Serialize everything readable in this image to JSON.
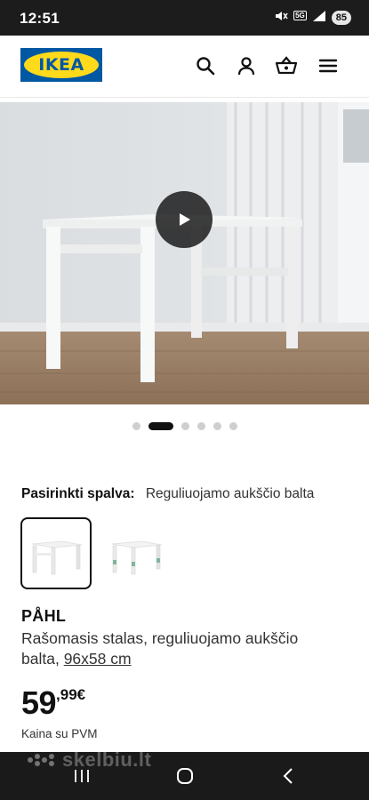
{
  "status_bar": {
    "time": "12:51",
    "network": "5G",
    "battery": "85"
  },
  "header": {
    "logo_text": "IKEA",
    "icons": [
      "search-icon",
      "user-icon",
      "basket-icon",
      "menu-icon"
    ]
  },
  "gallery": {
    "dot_count": 6,
    "active_dot": 1
  },
  "color_select": {
    "label": "Pasirinkti spalva:",
    "value": "Reguliuojamo aukščio balta"
  },
  "product": {
    "name": "PÅHL",
    "description": "Rašomasis stalas, reguliuojamo aukščio",
    "color": "balta,",
    "size": "96x58 cm",
    "price_int": "59",
    "price_dec": ",99€",
    "vat_note": "Kaina su PVM"
  },
  "watermark": "skelbiu.lt",
  "colors": {
    "ikea_blue": "#0058a3",
    "ikea_yellow": "#ffda1a"
  }
}
